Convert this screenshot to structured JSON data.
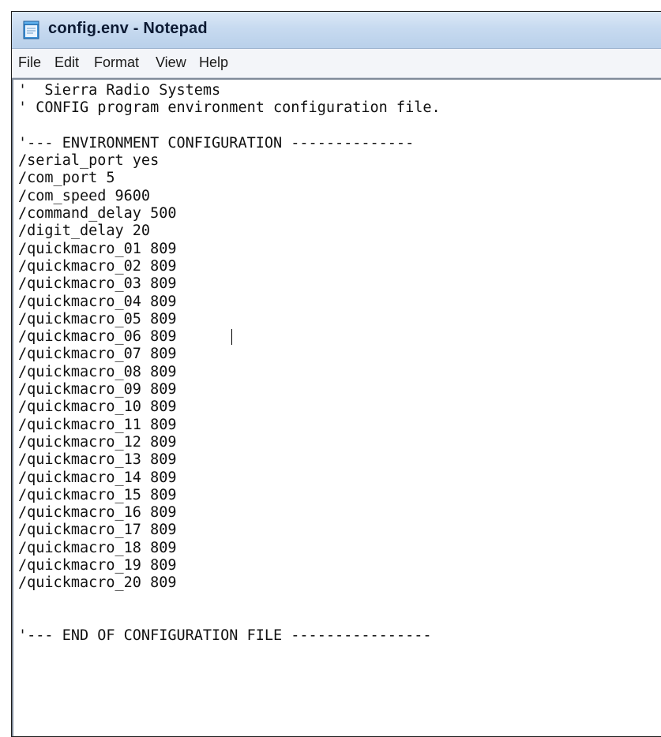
{
  "window": {
    "title": "config.env - Notepad",
    "icon": "notepad-icon"
  },
  "menu": {
    "items": [
      "File",
      "Edit",
      "Format",
      "View",
      "Help"
    ]
  },
  "editor": {
    "lines": [
      "'  Sierra Radio Systems",
      "' CONFIG program environment configuration file.",
      "",
      "'--- ENVIRONMENT CONFIGURATION --------------",
      "/serial_port yes",
      "/com_port 5",
      "/com_speed 9600",
      "/command_delay 500",
      "/digit_delay 20",
      "/quickmacro_01 809",
      "/quickmacro_02 809",
      "/quickmacro_03 809",
      "/quickmacro_04 809",
      "/quickmacro_05 809",
      "/quickmacro_06 809",
      "/quickmacro_07 809",
      "/quickmacro_08 809",
      "/quickmacro_09 809",
      "/quickmacro_10 809",
      "/quickmacro_11 809",
      "/quickmacro_12 809",
      "/quickmacro_13 809",
      "/quickmacro_14 809",
      "/quickmacro_15 809",
      "/quickmacro_16 809",
      "/quickmacro_17 809",
      "/quickmacro_18 809",
      "/quickmacro_19 809",
      "/quickmacro_20 809",
      "",
      "",
      "'--- END OF CONFIGURATION FILE ----------------"
    ]
  },
  "colors": {
    "titlebar": "#c7daf0",
    "menubar": "#f3f5f9",
    "text": "#111111"
  }
}
